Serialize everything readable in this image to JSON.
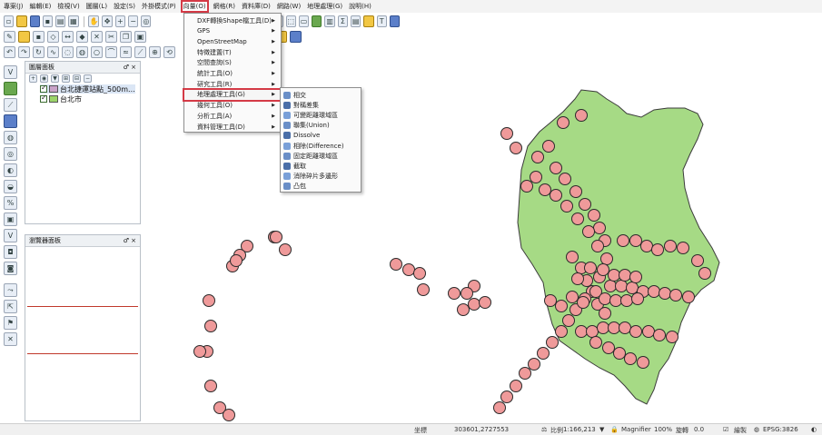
{
  "menubar": {
    "items": [
      "專案(J)",
      "編輯(E)",
      "檢視(V)",
      "圖層(L)",
      "設定(S)",
      "外掛模式(P)",
      "向量(O)",
      "網格(R)",
      "資料庫(D)",
      "網路(W)",
      "地理處理(G)",
      "說明(H)"
    ]
  },
  "layers_panel": {
    "title": "圖層面板",
    "close_glyph": "♂ ×",
    "layers": [
      {
        "name": "台北捷運站點_500m...",
        "swatch": "#c9a3c9"
      },
      {
        "name": "台北市",
        "swatch": "#9cd46a"
      }
    ]
  },
  "browser_panel": {
    "title": "瀏覽器面板",
    "close_glyph": "♂ ×"
  },
  "vector_menu": {
    "items": [
      {
        "label": "DXF轉換Shape檔工具(D)",
        "submenu": true
      },
      {
        "label": "GPS",
        "submenu": true
      },
      {
        "label": "OpenStreetMap",
        "submenu": true
      },
      {
        "label": "特徵建置(T)",
        "submenu": true
      },
      {
        "label": "空間查詢(S)",
        "submenu": true
      },
      {
        "label": "統計工具(O)",
        "submenu": true
      },
      {
        "label": "研究工具(R)",
        "submenu": true
      },
      {
        "label": "地理處理工具(G)",
        "submenu": true
      },
      {
        "label": "幾何工具(O)",
        "submenu": true
      },
      {
        "label": "分析工具(A)",
        "submenu": true
      },
      {
        "label": "資料管理工具(D)",
        "submenu": true
      }
    ]
  },
  "geoprocessing_submenu": {
    "items": [
      {
        "label": "相交",
        "icon": "intersect-icon"
      },
      {
        "label": "對稱差集",
        "icon": "symmetric-difference-icon"
      },
      {
        "label": "可變距離環域區",
        "icon": "variable-buffer-icon"
      },
      {
        "label": "聯集(Union)",
        "icon": "union-icon"
      },
      {
        "label": "Dissolve",
        "icon": "dissolve-icon"
      },
      {
        "label": "相除(Difference)",
        "icon": "difference-icon"
      },
      {
        "label": "固定距離環域區",
        "icon": "fixed-buffer-icon"
      },
      {
        "label": "截取",
        "icon": "clip-icon"
      },
      {
        "label": "消除碎片多邊形",
        "icon": "eliminate-icon"
      },
      {
        "label": "凸包",
        "icon": "convex-hull-icon"
      }
    ]
  },
  "statusbar": {
    "coord_label": "坐標",
    "coord_value": "303601,2727553",
    "scale_label": "比例",
    "scale_value": "1:166,213",
    "magnifier_label": "Magnifier",
    "magnifier_value": "100%",
    "rotation_label": "旋轉",
    "rotation_value": "0.0",
    "render_label": "繪製",
    "crs_label": "EPSG:3826"
  },
  "colors": {
    "polygon_fill": "#a6da85",
    "polygon_stroke": "#3b3b3b",
    "buffer_fill": "#ef9a9a",
    "buffer_stroke": "#2a2a2a",
    "highlight": "#d43a46"
  }
}
